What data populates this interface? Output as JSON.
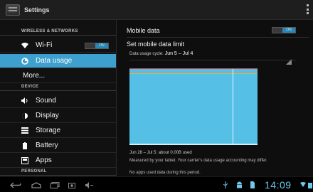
{
  "app": {
    "title": "Settings",
    "icon": "settings-app-icon"
  },
  "sidebar": {
    "section_wireless": "WIRELESS & NETWORKS",
    "wifi": {
      "label": "Wi-Fi",
      "toggle": "ON",
      "icon": "wifi-icon"
    },
    "data_usage": {
      "label": "Data usage",
      "icon": "data-usage-icon"
    },
    "more": {
      "label": "More..."
    },
    "section_device": "DEVICE",
    "sound": {
      "label": "Sound",
      "icon": "volume-icon"
    },
    "display": {
      "label": "Display",
      "icon": "brightness-icon"
    },
    "storage": {
      "label": "Storage",
      "icon": "storage-icon"
    },
    "battery": {
      "label": "Battery",
      "icon": "battery-icon"
    },
    "apps": {
      "label": "Apps",
      "icon": "apps-icon"
    },
    "section_personal": "PERSONAL"
  },
  "content": {
    "mobile_data": {
      "label": "Mobile data",
      "toggle": "ON"
    },
    "set_limit": {
      "label": "Set mobile data limit"
    },
    "cycle": {
      "label": "Data usage cycle:",
      "value": "Jun 5 – Jul 4"
    },
    "chart": {
      "limit_label": "",
      "warning_label": "",
      "start_handle": "",
      "end_handle": ""
    },
    "usage_text": "Jun 28 – Jul 5: about 0.00B used",
    "measured_note": "Measured by your tablet. Your carrier's data usage accounting may differ.",
    "no_apps": "No apps used data during this period."
  },
  "navbar": {
    "clock": "14:09"
  },
  "colors": {
    "accent": "#3ea0ce",
    "chart_fill": "#55bfe6",
    "limit_line": "#d84545",
    "warning_line": "#f2a93a",
    "clock": "#6fc7ec"
  }
}
